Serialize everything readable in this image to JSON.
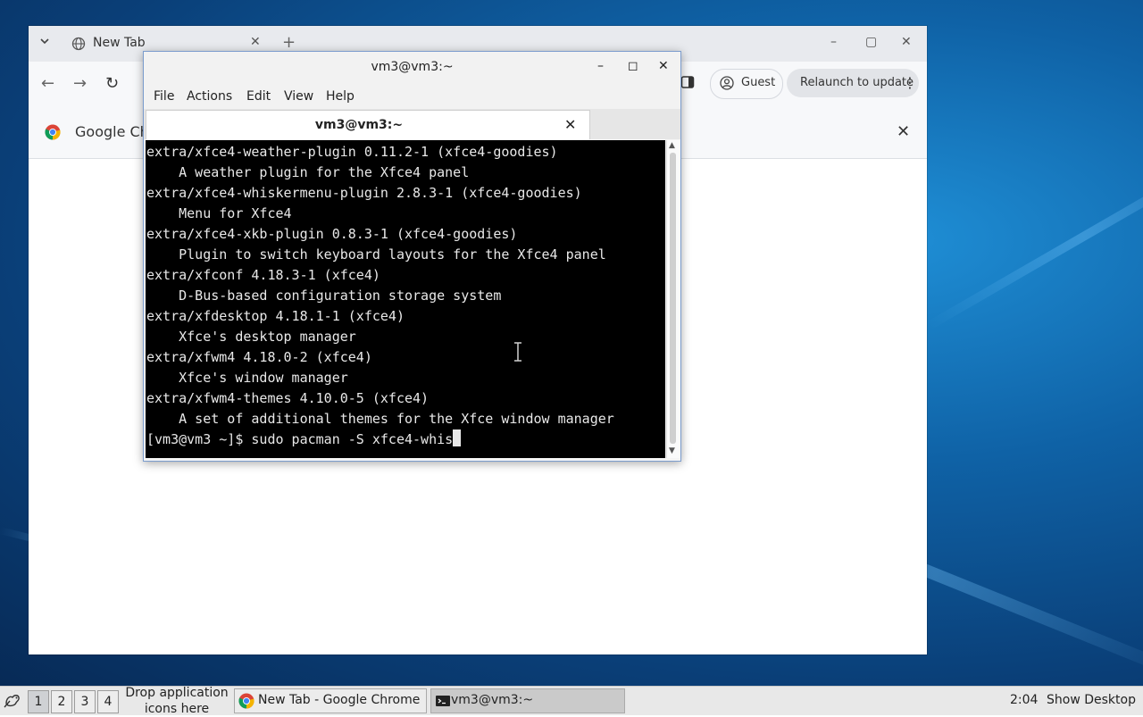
{
  "chrome": {
    "tab_title": "New Tab",
    "tab_close": "✕",
    "new_tab": "+",
    "win_min": "–",
    "win_max": "▢",
    "win_close": "✕",
    "back": "←",
    "forward": "→",
    "reload": "↻",
    "guest_label": "Guest",
    "relaunch_label": "Relaunch to update",
    "relaunch_menu": "⋮",
    "infobar_text": "Google Ch",
    "infobar_close": "✕"
  },
  "terminal": {
    "title": "vm3@vm3:~",
    "btn_min": "–",
    "btn_max": "◻",
    "btn_close": "✕",
    "menu": [
      "File",
      "Actions",
      "Edit",
      "View",
      "Help"
    ],
    "tab_label": "vm3@vm3:~",
    "tab_close": "✕",
    "lines": [
      "extra/xfce4-weather-plugin 0.11.2-1 (xfce4-goodies)",
      "    A weather plugin for the Xfce4 panel",
      "extra/xfce4-whiskermenu-plugin 2.8.3-1 (xfce4-goodies)",
      "    Menu for Xfce4",
      "extra/xfce4-xkb-plugin 0.8.3-1 (xfce4-goodies)",
      "    Plugin to switch keyboard layouts for the Xfce4 panel",
      "extra/xfconf 4.18.3-1 (xfce4)",
      "    D-Bus-based configuration storage system",
      "extra/xfdesktop 4.18.1-1 (xfce4)",
      "    Xfce's desktop manager",
      "extra/xfwm4 4.18.0-2 (xfce4)",
      "    Xfce's window manager",
      "extra/xfwm4-themes 4.10.0-5 (xfce4)",
      "    A set of additional themes for the Xfce window manager"
    ],
    "prompt": "[vm3@vm3 ~]$ sudo pacman -S xfce4-whis"
  },
  "taskbar": {
    "workspaces": [
      "1",
      "2",
      "3",
      "4"
    ],
    "drop_text": "Drop application icons here",
    "tasks": [
      "New Tab - Google Chrome",
      "vm3@vm3:~"
    ],
    "clock": "2:04",
    "show_desktop": "Show Desktop"
  },
  "colors": {
    "desktop_bg": "#0f62a6",
    "terminal_bg": "#000000",
    "terminal_fg": "#e8e8e8"
  }
}
